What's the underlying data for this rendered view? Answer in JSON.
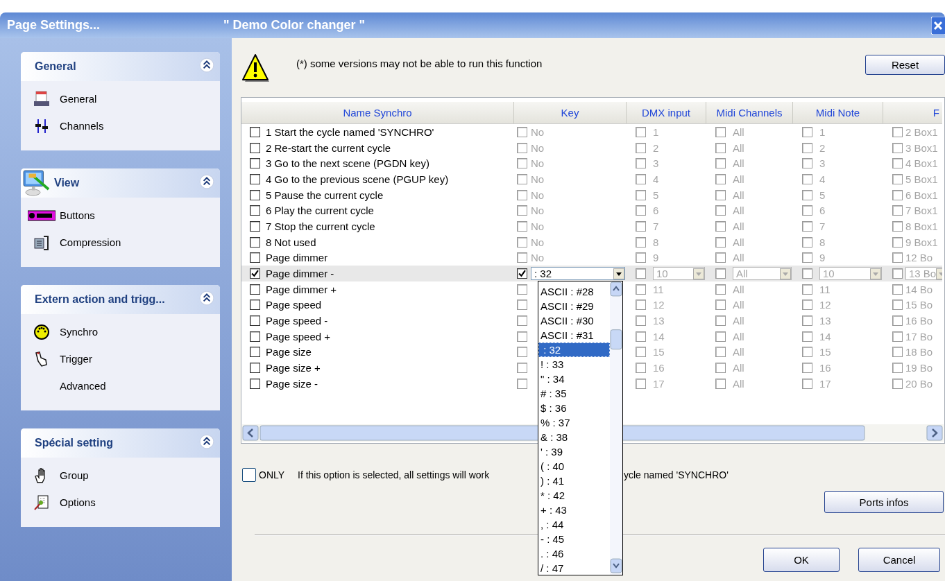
{
  "window": {
    "title": "Page  Settings...",
    "document": "\" Demo Color changer \""
  },
  "sidebar": {
    "groups": [
      {
        "title": "General",
        "expanded": true,
        "items": [
          {
            "label": "General"
          },
          {
            "label": "Channels"
          }
        ]
      },
      {
        "title": "View",
        "expanded": true,
        "items": [
          {
            "label": "Buttons"
          },
          {
            "label": "Compression"
          }
        ]
      },
      {
        "title": "Extern action and trigg...",
        "expanded": true,
        "items": [
          {
            "label": "Synchro"
          },
          {
            "label": "Trigger"
          },
          {
            "label": "Advanced"
          }
        ]
      },
      {
        "title": "Spécial setting",
        "expanded": true,
        "items": [
          {
            "label": "Group"
          },
          {
            "label": "Options"
          }
        ]
      }
    ]
  },
  "notice": {
    "text": "(*) some versions may not be able to run this function"
  },
  "reset_button": "Reset",
  "table": {
    "columns": [
      "Name Synchro",
      "Key",
      "DMX input",
      "Midi Channels",
      "Midi Note",
      "F"
    ],
    "rows": [
      {
        "name": "1  Start the cycle named 'SYNCHRO'",
        "checked": false,
        "selected": false,
        "key_checked": false,
        "key": "No",
        "dmx": "1",
        "midi_channel": "All",
        "midi_note": "1",
        "column_6": "2 Box1"
      },
      {
        "name": "2  Re-start the current cycle",
        "checked": false,
        "selected": false,
        "key_checked": false,
        "key": "No",
        "dmx": "2",
        "midi_channel": "All",
        "midi_note": "2",
        "column_6": "3 Box1"
      },
      {
        "name": "3  Go to the next scene (PGDN key)",
        "checked": false,
        "selected": false,
        "key_checked": false,
        "key": "No",
        "dmx": "3",
        "midi_channel": "All",
        "midi_note": "3",
        "column_6": "4 Box1"
      },
      {
        "name": "4  Go to the previous scene (PGUP key)",
        "checked": false,
        "selected": false,
        "key_checked": false,
        "key": "No",
        "dmx": "4",
        "midi_channel": "All",
        "midi_note": "4",
        "column_6": "5 Box1"
      },
      {
        "name": "5  Pause the current cycle",
        "checked": false,
        "selected": false,
        "key_checked": false,
        "key": "No",
        "dmx": "5",
        "midi_channel": "All",
        "midi_note": "5",
        "column_6": "6 Box1"
      },
      {
        "name": "6  Play the current cycle",
        "checked": false,
        "selected": false,
        "key_checked": false,
        "key": "No",
        "dmx": "6",
        "midi_channel": "All",
        "midi_note": "6",
        "column_6": "7 Box1"
      },
      {
        "name": "7  Stop the current cycle",
        "checked": false,
        "selected": false,
        "key_checked": false,
        "key": "No",
        "dmx": "7",
        "midi_channel": "All",
        "midi_note": "7",
        "column_6": "8 Box1"
      },
      {
        "name": "8 Not used",
        "checked": false,
        "selected": false,
        "key_checked": false,
        "key": "No",
        "dmx": "8",
        "midi_channel": "All",
        "midi_note": "8",
        "column_6": "9 Box1"
      },
      {
        "name": "Page dimmer",
        "checked": false,
        "selected": false,
        "key_checked": false,
        "key": "No",
        "dmx": "9",
        "midi_channel": "All",
        "midi_note": "9",
        "column_6": "12 Bo"
      },
      {
        "name": "Page dimmer -",
        "checked": true,
        "selected": true,
        "key_checked": true,
        "key": ": 32",
        "dmx": "10",
        "midi_channel": "All",
        "midi_note": "10",
        "column_6": "13 Bo"
      },
      {
        "name": "Page dimmer +",
        "checked": false,
        "selected": false,
        "key_checked": false,
        "dmx": "11",
        "midi_channel": "All",
        "midi_note": "11",
        "column_6": "14 Bo"
      },
      {
        "name": "Page speed",
        "checked": false,
        "selected": false,
        "key_checked": false,
        "dmx": "12",
        "midi_channel": "All",
        "midi_note": "12",
        "column_6": "15 Bo"
      },
      {
        "name": "Page speed -",
        "checked": false,
        "selected": false,
        "key_checked": false,
        "dmx": "13",
        "midi_channel": "All",
        "midi_note": "13",
        "column_6": "16 Bo"
      },
      {
        "name": "Page speed +",
        "checked": false,
        "selected": false,
        "key_checked": false,
        "dmx": "14",
        "midi_channel": "All",
        "midi_note": "14",
        "column_6": "17 Bo"
      },
      {
        "name": "Page size",
        "checked": false,
        "selected": false,
        "key_checked": false,
        "dmx": "15",
        "midi_channel": "All",
        "midi_note": "15",
        "column_6": "18 Bo"
      },
      {
        "name": "Page size +",
        "checked": false,
        "selected": false,
        "key_checked": false,
        "dmx": "16",
        "midi_channel": "All",
        "midi_note": "16",
        "column_6": "19 Bo"
      },
      {
        "name": "Page size -",
        "checked": false,
        "selected": false,
        "key_checked": false,
        "dmx": "17",
        "midi_channel": "All",
        "midi_note": "17",
        "column_6": "20 Bo"
      }
    ],
    "key_dropdown": {
      "items": [
        {
          "label": "ASCII : #28",
          "selected": false
        },
        {
          "label": "ASCII : #29",
          "selected": false
        },
        {
          "label": "ASCII : #30",
          "selected": false
        },
        {
          "label": "ASCII : #31",
          "selected": false
        },
        {
          "label": " : 32",
          "selected": true
        },
        {
          "label": "! : 33",
          "selected": false
        },
        {
          "label": "\" : 34",
          "selected": false
        },
        {
          "label": "# : 35",
          "selected": false
        },
        {
          "label": "$ : 36",
          "selected": false
        },
        {
          "label": "% : 37",
          "selected": false
        },
        {
          "label": "& : 38",
          "selected": false
        },
        {
          "label": "' : 39",
          "selected": false
        },
        {
          "label": "( : 40",
          "selected": false
        },
        {
          "label": ") : 41",
          "selected": false
        },
        {
          "label": "* : 42",
          "selected": false
        },
        {
          "label": "+ : 43",
          "selected": false
        },
        {
          "label": ", : 44",
          "selected": false
        },
        {
          "label": "- : 45",
          "selected": false
        },
        {
          "label": ". : 46",
          "selected": false
        },
        {
          "label": "/ : 47",
          "selected": false
        }
      ]
    }
  },
  "only_option": {
    "checked": false,
    "label": "ONLY",
    "text_before": "If this option is selected, all settings will work",
    "text_after": "ycle named 'SYNCHRO'"
  },
  "buttons": {
    "ports": "Ports infos",
    "ok": "OK",
    "cancel": "Cancel"
  }
}
